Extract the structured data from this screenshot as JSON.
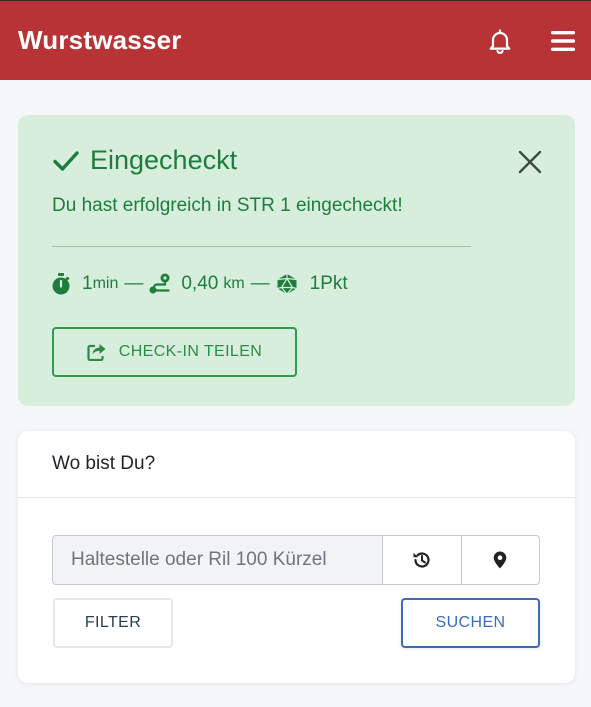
{
  "navbar": {
    "brand": "Wurstwasser",
    "color": "#b73336",
    "icons": [
      "bell-icon",
      "hamburger-menu-icon"
    ]
  },
  "alert": {
    "title": "Eingecheckt",
    "message": "Du hast erfolgreich in STR 1 eingecheckt!",
    "duration_value": "1",
    "duration_unit": "min",
    "separator": "—",
    "distance_value": "0,40",
    "distance_unit": "km",
    "points_value": "1",
    "points_unit": "Pkt",
    "share_label": "CHECK-IN TEILEN",
    "background": "#d8eedd",
    "text_color": "#1e7d3d",
    "icons": [
      "check-icon",
      "close-icon",
      "stopwatch-icon",
      "route-icon",
      "dice-icon",
      "share-icon"
    ]
  },
  "search_card": {
    "title": "Wo bist Du?",
    "input_placeholder": "Haltestelle oder Ril 100 Kürzel",
    "input_value": "",
    "filter_label": "FILTER",
    "submit_label": "SUCHEN",
    "accent": "#3d6cb4",
    "icons": [
      "history-icon",
      "location-pin-icon"
    ]
  }
}
